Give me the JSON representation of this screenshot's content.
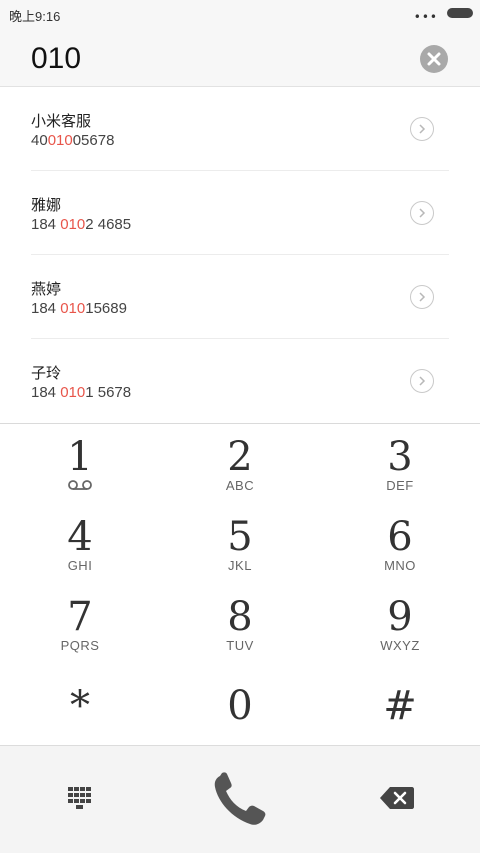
{
  "status_bar": {
    "time": "晚上9:16",
    "dots": "•••"
  },
  "dialer": {
    "input_value": "010"
  },
  "results": [
    {
      "name": "小米客服",
      "number_prefix": "40",
      "number_match": "010",
      "number_suffix": "05678"
    },
    {
      "name": "雅娜",
      "number_prefix": "184 ",
      "number_match": "010",
      "number_suffix": "2 4685"
    },
    {
      "name": "燕婷",
      "number_prefix": "184 ",
      "number_match": "010",
      "number_suffix": "15689"
    },
    {
      "name": "子玲",
      "number_prefix": "184 ",
      "number_match": "010",
      "number_suffix": "1 5678"
    }
  ],
  "keypad": {
    "keys": [
      {
        "digit": "1",
        "letters": ""
      },
      {
        "digit": "2",
        "letters": "ABC"
      },
      {
        "digit": "3",
        "letters": "DEF"
      },
      {
        "digit": "4",
        "letters": "GHI"
      },
      {
        "digit": "5",
        "letters": "JKL"
      },
      {
        "digit": "6",
        "letters": "MNO"
      },
      {
        "digit": "7",
        "letters": "PQRS"
      },
      {
        "digit": "8",
        "letters": "TUV"
      },
      {
        "digit": "9",
        "letters": "WXYZ"
      },
      {
        "digit": "*",
        "letters": ""
      },
      {
        "digit": "0",
        "letters": ""
      },
      {
        "digit": "#",
        "letters": ""
      }
    ]
  },
  "colors": {
    "highlight": "#e8554a",
    "call_icon": "#555555",
    "clear_button": "#a9a9a9"
  },
  "icons": {
    "clear": "close-circle-icon",
    "detail": "chevron-right-circle-icon",
    "voicemail": "voicemail-icon",
    "dialpad": "dialpad-grid-icon",
    "call": "phone-handset-icon",
    "backspace": "backspace-icon"
  }
}
